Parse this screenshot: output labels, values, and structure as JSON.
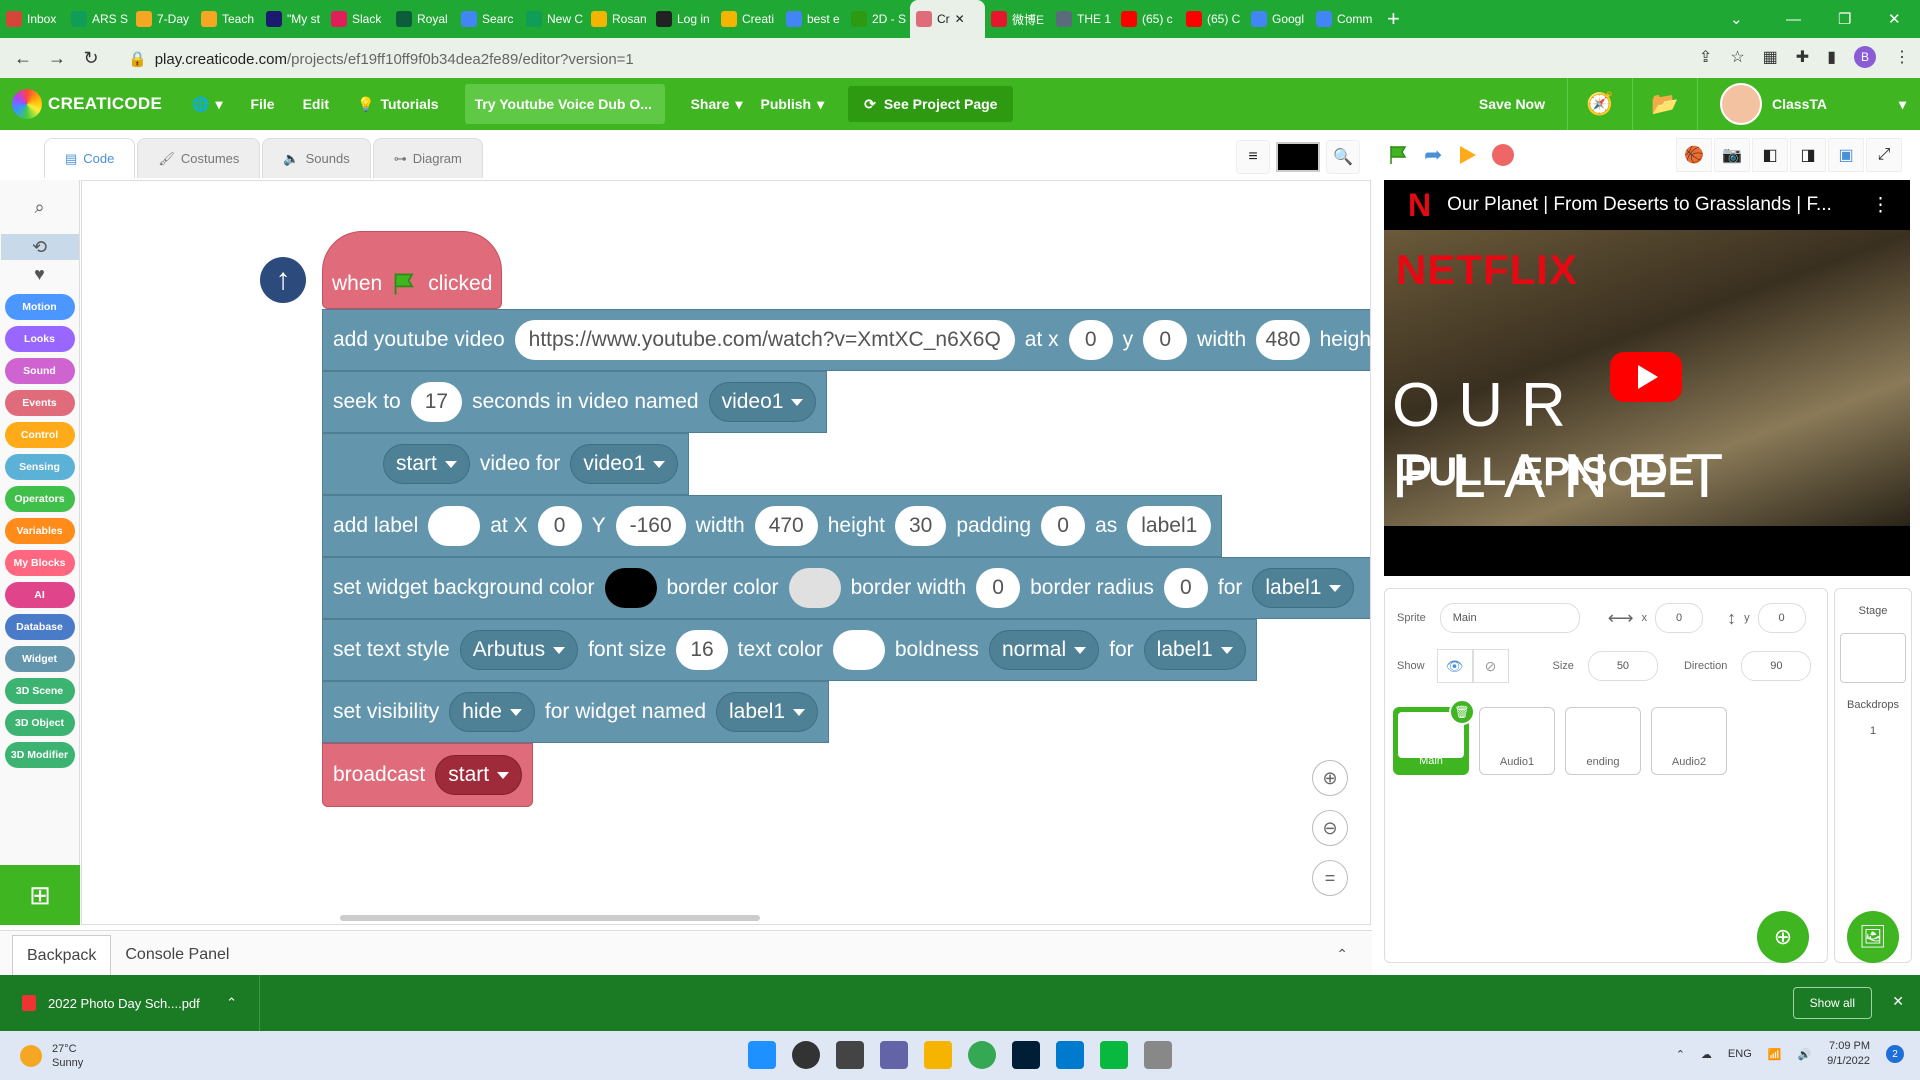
{
  "browser": {
    "tabs": [
      {
        "label": "Inbox",
        "color": "#d44638"
      },
      {
        "label": "ARS S",
        "color": "#0f9d58"
      },
      {
        "label": "7-Day",
        "color": "#f5a623"
      },
      {
        "label": "Teach",
        "color": "#f5a623"
      },
      {
        "label": "\"My st",
        "color": "#1a1a6e"
      },
      {
        "label": "Slack",
        "color": "#e01e5a"
      },
      {
        "label": "Royal",
        "color": "#0b5d3b"
      },
      {
        "label": "Searc",
        "color": "#4285f4"
      },
      {
        "label": "New C",
        "color": "#0f9d58"
      },
      {
        "label": "Rosan",
        "color": "#f4b400"
      },
      {
        "label": "Log in",
        "color": "#222222"
      },
      {
        "label": "Creati",
        "color": "#f4b400"
      },
      {
        "label": "best e",
        "color": "#4285f4"
      },
      {
        "label": "2D - S",
        "color": "#2d9a12"
      },
      {
        "label": "Cr",
        "color": "#e06b7a",
        "active": true
      },
      {
        "label": "微博E",
        "color": "#e6162d"
      },
      {
        "label": "THE 1",
        "color": "#5a6b7c"
      },
      {
        "label": "(65) c",
        "color": "#ff0000"
      },
      {
        "label": "(65) C",
        "color": "#ff0000"
      },
      {
        "label": "Googl",
        "color": "#4285f4"
      },
      {
        "label": "Comm",
        "color": "#4285f4"
      }
    ],
    "url_host": "play.creaticode.com",
    "url_path": "/projects/ef19ff10ff9f0b34dea2fe89/editor?version=1",
    "profile_initial": "B"
  },
  "app": {
    "brand": "CREATICODE",
    "menu": {
      "file": "File",
      "edit": "Edit",
      "tutorials": "Tutorials",
      "highlight": "Try Youtube Voice Dub O...",
      "share": "Share",
      "publish": "Publish",
      "see_project": "See Project Page",
      "save": "Save Now"
    },
    "user": "ClassTA"
  },
  "editor_tabs": {
    "code": "Code",
    "costumes": "Costumes",
    "sounds": "Sounds",
    "diagram": "Diagram"
  },
  "categories": [
    {
      "label": "Motion",
      "color": "#4c97ff"
    },
    {
      "label": "Looks",
      "color": "#9966ff"
    },
    {
      "label": "Sound",
      "color": "#cf63cf"
    },
    {
      "label": "Events",
      "color": "#e06b7a"
    },
    {
      "label": "Control",
      "color": "#ffab19"
    },
    {
      "label": "Sensing",
      "color": "#5cb1d6"
    },
    {
      "label": "Operators",
      "color": "#40bf4a"
    },
    {
      "label": "Variables",
      "color": "#ff8c1a"
    },
    {
      "label": "My Blocks",
      "color": "#ff6680"
    },
    {
      "label": "AI",
      "color": "#e0458b"
    },
    {
      "label": "Database",
      "color": "#4a7bc8"
    },
    {
      "label": "Widget",
      "color": "#6396ad"
    },
    {
      "label": "3D Scene",
      "color": "#3cb371"
    },
    {
      "label": "3D Object",
      "color": "#3cb371"
    },
    {
      "label": "3D Modifier",
      "color": "#3cb371"
    }
  ],
  "blocks": {
    "hat": {
      "when": "when",
      "clicked": "clicked"
    },
    "youtube": {
      "label": "add youtube video",
      "url": "https://www.youtube.com/watch?v=XmtXC_n6X6Q",
      "at_x": "at x",
      "x": "0",
      "y_label": "y",
      "y": "0",
      "width_label": "width",
      "width": "480",
      "height_label": "heigh"
    },
    "seek": {
      "label": "seek to",
      "seconds": "17",
      "mid": "seconds in video named",
      "video": "video1"
    },
    "start": {
      "action": "start",
      "mid": "video for",
      "video": "video1"
    },
    "label": {
      "label": "add label",
      "text": "",
      "atx": "at X",
      "x": "0",
      "ylabel": "Y",
      "y": "-160",
      "wlabel": "width",
      "w": "470",
      "hlabel": "height",
      "h": "30",
      "plabel": "padding",
      "p": "0",
      "as": "as",
      "name": "label1"
    },
    "bg": {
      "label": "set widget background color",
      "bg_color": "#000000",
      "border_label": "border color",
      "border_color": "#e0e0e0",
      "bw_label": "border width",
      "bw": "0",
      "br_label": "border radius",
      "br": "0",
      "for": "for",
      "name": "label1"
    },
    "text_style": {
      "label": "set text style",
      "font": "Arbutus",
      "fs_label": "font size",
      "fs": "16",
      "tc_label": "text color",
      "text_color": "#ffffff",
      "bold_label": "boldness",
      "bold": "normal",
      "for": "for",
      "name": "label1"
    },
    "visibility": {
      "label": "set visibility",
      "value": "hide",
      "mid": "for widget named",
      "name": "label1"
    },
    "broadcast": {
      "label": "broadcast",
      "message": "start"
    }
  },
  "bottom_panel": {
    "backpack": "Backpack",
    "console": "Console Panel"
  },
  "video": {
    "title": "Our Planet | From Deserts to Grasslands | F...",
    "netflix": "NETFLIX",
    "planet": "OUR PLANET",
    "episode": "FULL EPISODE"
  },
  "sprite": {
    "sprite_label": "Sprite",
    "name": "Main",
    "x_label": "x",
    "x": "0",
    "y_label": "y",
    "y": "0",
    "show_label": "Show",
    "size_label": "Size",
    "size": "50",
    "direction_label": "Direction",
    "direction": "90",
    "thumbs": [
      "Main",
      "Audio1",
      "ending",
      "Audio2"
    ]
  },
  "stage": {
    "label": "Stage",
    "backdrops_label": "Backdrops",
    "backdrops": "1"
  },
  "download": {
    "file": "2022 Photo Day Sch....pdf",
    "show_all": "Show all"
  },
  "taskbar": {
    "temp": "27°C",
    "weather": "Sunny",
    "lang": "ENG",
    "time": "7:09 PM",
    "date": "9/1/2022",
    "notif": "2"
  }
}
